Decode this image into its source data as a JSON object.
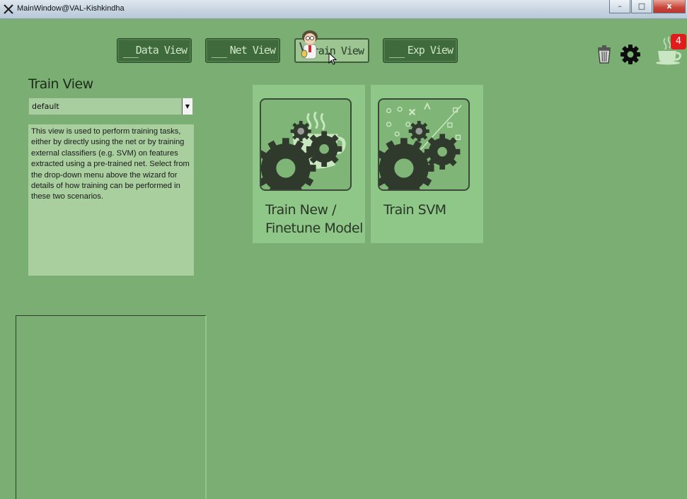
{
  "window": {
    "title": "MainWindow@VAL-Kishkindha",
    "minimize": "–",
    "maximize": "□",
    "close": "x"
  },
  "tabs": [
    {
      "label": "Data View",
      "active": false
    },
    {
      "label": "Net View",
      "active": false
    },
    {
      "label": "Train View",
      "active": true
    },
    {
      "label": "Exp View",
      "active": false
    }
  ],
  "toolbar": {
    "notification_count": "4",
    "icons": [
      "trash-icon",
      "gear-icon",
      "cup-icon"
    ]
  },
  "left_panel": {
    "title": "Train View",
    "dropdown_value": "default",
    "description": "This view is used to perform training tasks, either by directly using the net or by training external classifiers (e.g. SVM) on features extracted using a pre-trained net. Select from the drop-down menu above the wizard for details of how training can be performed in these two scenarios."
  },
  "cards": [
    {
      "title": "Train New /\nFinetune Model",
      "icon": "gears-coffee-icon"
    },
    {
      "title": "Train SVM",
      "icon": "gears-scatter-icon"
    }
  ],
  "colors": {
    "background": "#7aae72",
    "card": "#8fc788",
    "tab": "#3f6a3c",
    "badge": "#e21c1c"
  }
}
